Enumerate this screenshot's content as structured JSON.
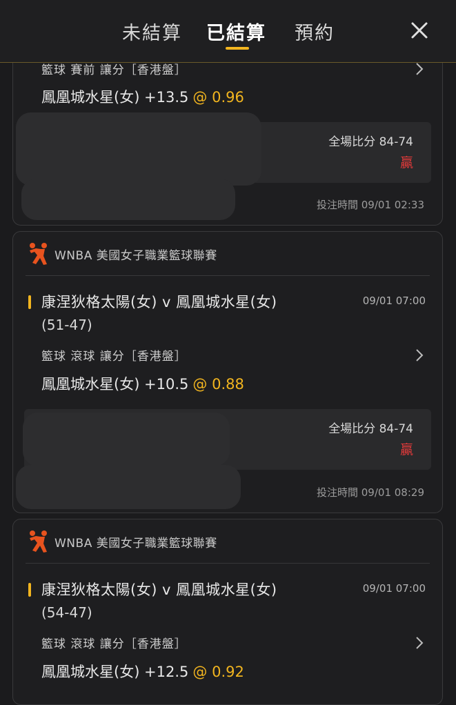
{
  "header": {
    "tabs": [
      {
        "label": "未結算"
      },
      {
        "label": "已結算"
      },
      {
        "label": "預約"
      }
    ],
    "active_tab": "已結算"
  },
  "cards": [
    {
      "bet_type": "籃球 賽前 讓分［香港盤］",
      "selection": "鳳凰城水星(女) +13.5",
      "odds": "@ 0.96",
      "final_score_label": "全場比分 84-74",
      "result": "贏",
      "bet_time": "投注時間 09/01 02:33"
    },
    {
      "league": "WNBA 美國女子職業籃球聯賽",
      "match": "康涅狄格太陽(女) v 鳳凰城水星(女)",
      "match_time": "09/01 07:00",
      "live_score": "(51-47)",
      "bet_type": "籃球 滾球  讓分［香港盤］",
      "selection": "鳳凰城水星(女) +10.5",
      "odds": "@ 0.88",
      "final_score_label": "全場比分 84-74",
      "result": "贏",
      "bet_time": "投注時間 09/01 08:29"
    },
    {
      "league": "WNBA 美國女子職業籃球聯賽",
      "match": "康涅狄格太陽(女) v 鳳凰城水星(女)",
      "match_time": "09/01 07:00",
      "live_score": "(54-47)",
      "bet_type": "籃球 滾球  讓分［香港盤］",
      "selection": "鳳凰城水星(女) +12.5",
      "odds": "@ 0.92"
    }
  ],
  "colors": {
    "accent": "#f2b51f",
    "win": "#e23a3a",
    "background": "#1b1b1d",
    "card": "#1e1e20"
  },
  "icons": {
    "close": "close-icon",
    "chevron": "chevron-right-icon",
    "league": "basketball-player-icon"
  }
}
